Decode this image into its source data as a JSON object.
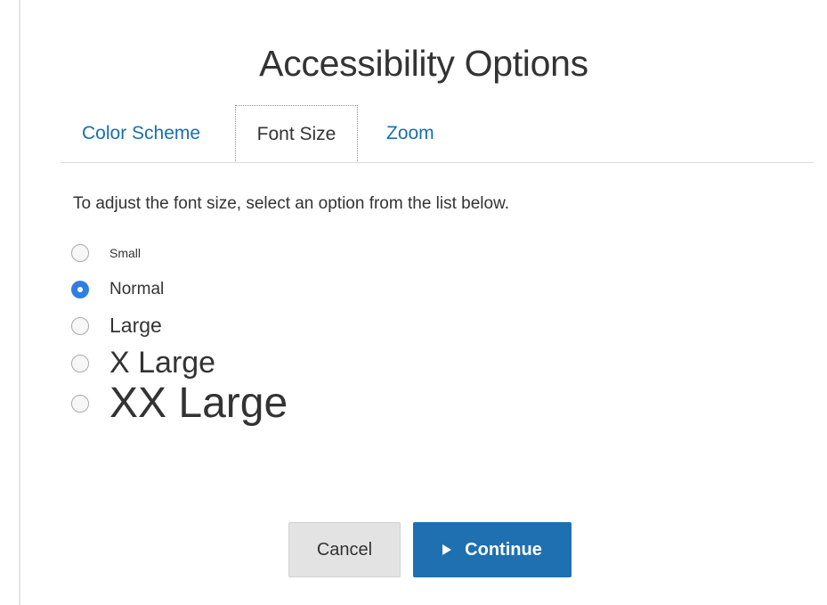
{
  "dialog": {
    "title": "Accessibility Options"
  },
  "tabs": [
    {
      "label": "Color Scheme",
      "active": false
    },
    {
      "label": "Font Size",
      "active": true
    },
    {
      "label": "Zoom",
      "active": false
    }
  ],
  "font_size_panel": {
    "instructions": "To adjust the font size, select an option from the list below.",
    "selected": "Normal",
    "options": [
      {
        "label": "Small"
      },
      {
        "label": "Normal"
      },
      {
        "label": "Large"
      },
      {
        "label": "X Large"
      },
      {
        "label": "XX Large"
      }
    ]
  },
  "buttons": {
    "cancel_label": "Cancel",
    "continue_label": "Continue",
    "continue_icon": "play-icon"
  },
  "colors": {
    "link": "#1a6fab",
    "primary_button": "#1e70b0",
    "radio_checked": "#2f7fdc",
    "secondary_button": "#e3e3e3"
  }
}
